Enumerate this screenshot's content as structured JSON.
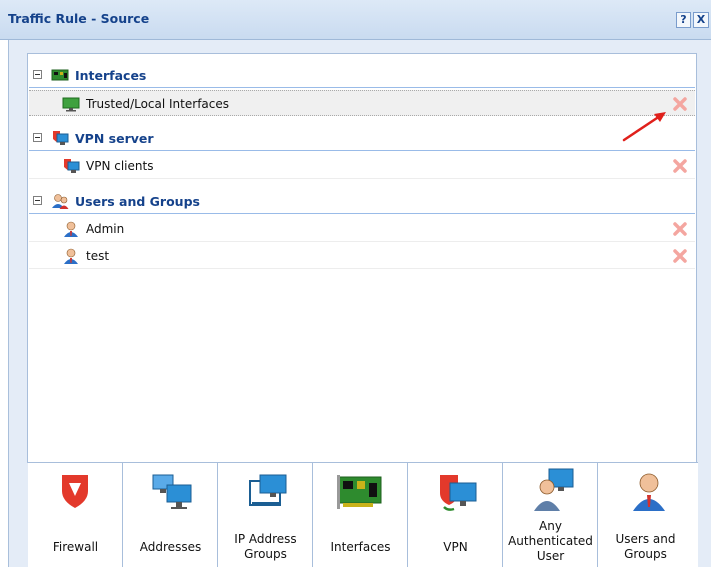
{
  "window": {
    "title": "Traffic Rule - Source",
    "help_button": "?",
    "close_button": "X"
  },
  "tree": {
    "groups": [
      {
        "label": "Interfaces",
        "icon": "network-card-icon",
        "items": [
          {
            "label": "Trusted/Local Interfaces",
            "icon": "monitor-icon",
            "selected": true
          }
        ]
      },
      {
        "label": "VPN server",
        "icon": "vpn-server-icon",
        "items": [
          {
            "label": "VPN clients",
            "icon": "vpn-client-icon",
            "selected": false
          }
        ]
      },
      {
        "label": "Users and Groups",
        "icon": "users-group-icon",
        "items": [
          {
            "label": "Admin",
            "icon": "user-icon",
            "selected": false
          },
          {
            "label": "test",
            "icon": "user-icon",
            "selected": false
          }
        ]
      }
    ]
  },
  "toolbar": {
    "buttons": [
      {
        "label": "Firewall",
        "icon": "shield-icon"
      },
      {
        "label": "Addresses",
        "icon": "computers-icon"
      },
      {
        "label": "IP Address Groups",
        "icon": "ip-group-icon"
      },
      {
        "label": "Interfaces",
        "icon": "network-card-icon"
      },
      {
        "label": "VPN",
        "icon": "vpn-icon"
      },
      {
        "label": "Any Authenticated User",
        "icon": "authenticated-user-icon"
      },
      {
        "label": "Users and Groups",
        "icon": "user-icon"
      }
    ]
  },
  "colors": {
    "header_text": "#15428b",
    "remove_icon": "#f4a6a0",
    "annotation_arrow": "#e0201b",
    "shield": "#e3392b"
  }
}
